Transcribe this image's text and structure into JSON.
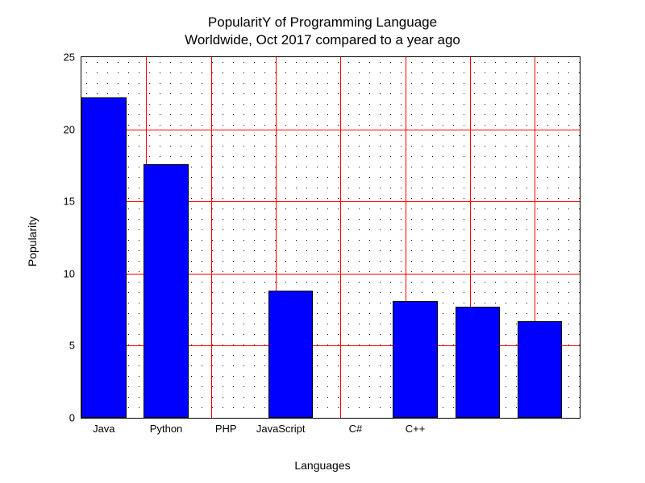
{
  "chart_data": {
    "type": "bar",
    "title_line1": "PopularitY of Programming Language",
    "title_line2": "Worldwide, Oct 2017 compared to a year ago",
    "xlabel": "Languages",
    "ylabel": "Popularity",
    "ylim": [
      0,
      25
    ],
    "yticks": [
      0,
      5,
      10,
      15,
      20,
      25
    ],
    "xtick_labels": [
      "Java",
      "Python",
      "PHP",
      "JavaScript",
      "C#",
      "C++"
    ],
    "categories": [
      "Java",
      "Python",
      "PHP",
      "JavaScript",
      "C#",
      "C++",
      "",
      ""
    ],
    "values": [
      22.2,
      17.6,
      0,
      8.8,
      0,
      8.1,
      7.7,
      6.7
    ],
    "bar_color": "#0000ff",
    "grid_color": "#ff0000",
    "x_positions_frac": [
      0.0,
      0.125,
      0.25,
      0.375,
      0.5,
      0.625,
      0.75,
      0.875
    ],
    "bar_width_frac": 0.09,
    "vgrid_frac": [
      0.0,
      0.13,
      0.26,
      0.39,
      0.52,
      0.65,
      0.78,
      0.91
    ],
    "xtick_frac": [
      0.045,
      0.17,
      0.29,
      0.4,
      0.55,
      0.67
    ]
  }
}
